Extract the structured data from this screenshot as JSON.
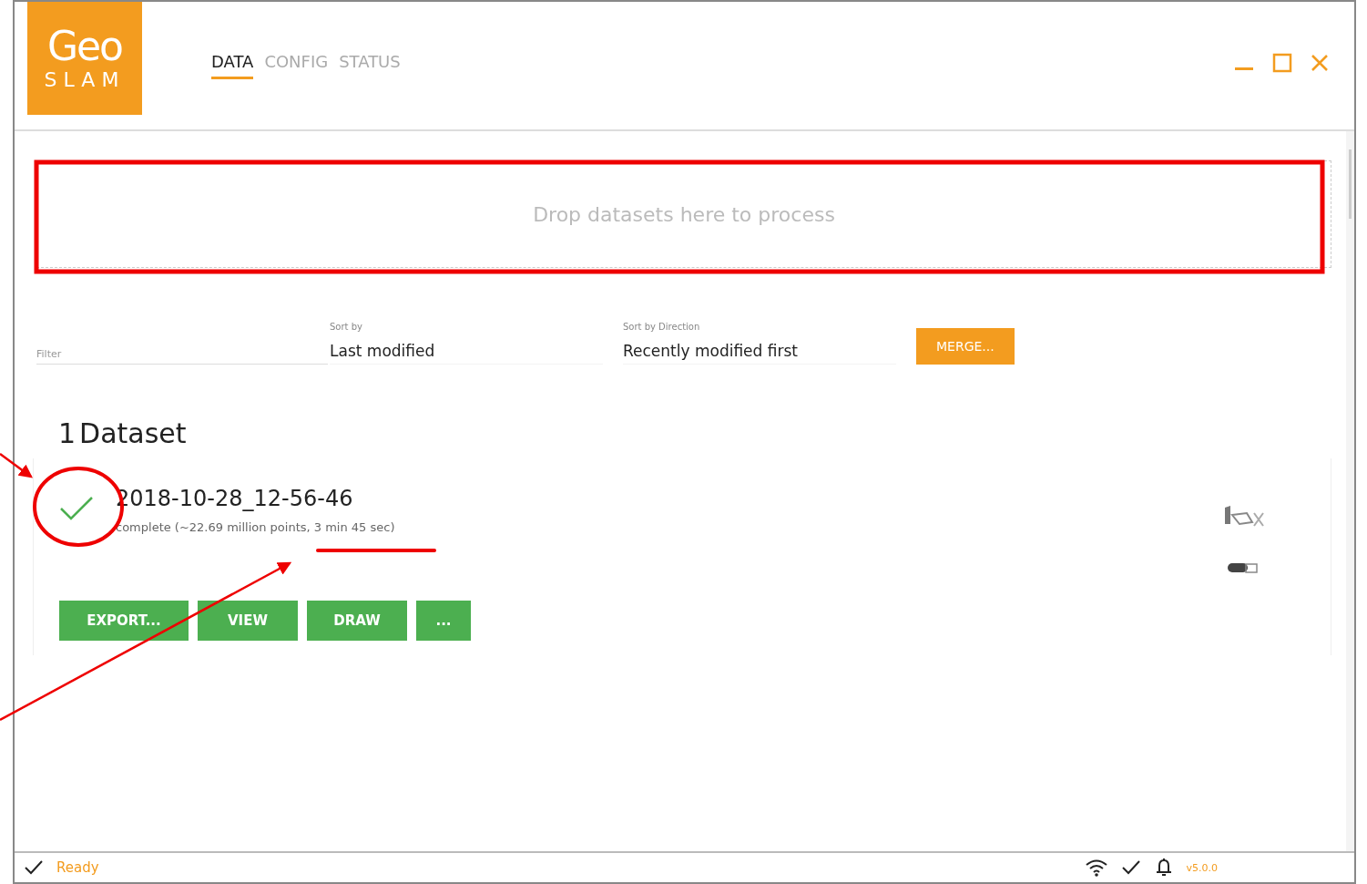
{
  "logo": {
    "mark": "Geo",
    "wordmark": "SLAM"
  },
  "tabs": [
    {
      "label": "DATA",
      "selected": true
    },
    {
      "label": "CONFIG",
      "selected": false
    },
    {
      "label": "STATUS",
      "selected": false
    }
  ],
  "drop_zone": {
    "text": "Drop datasets here to process"
  },
  "filter": {
    "placeholder": "Filter"
  },
  "sort_by": {
    "label": "Sort by",
    "value": "Last modified"
  },
  "sort_direction": {
    "label": "Sort by Direction",
    "value": "Recently modified first"
  },
  "merge_button": "MERGE...",
  "dataset_count": {
    "count": "1",
    "label": "Dataset"
  },
  "datasets": [
    {
      "name": "2018-10-28_12-56-46",
      "status": "complete (~22.69 million points, 3 min 45 sec)",
      "complete": true,
      "buttons": [
        "EXPORT...",
        "VIEW",
        "DRAW",
        "..."
      ]
    }
  ],
  "status_bar": {
    "text": "Ready",
    "version": "v5.0.0"
  }
}
